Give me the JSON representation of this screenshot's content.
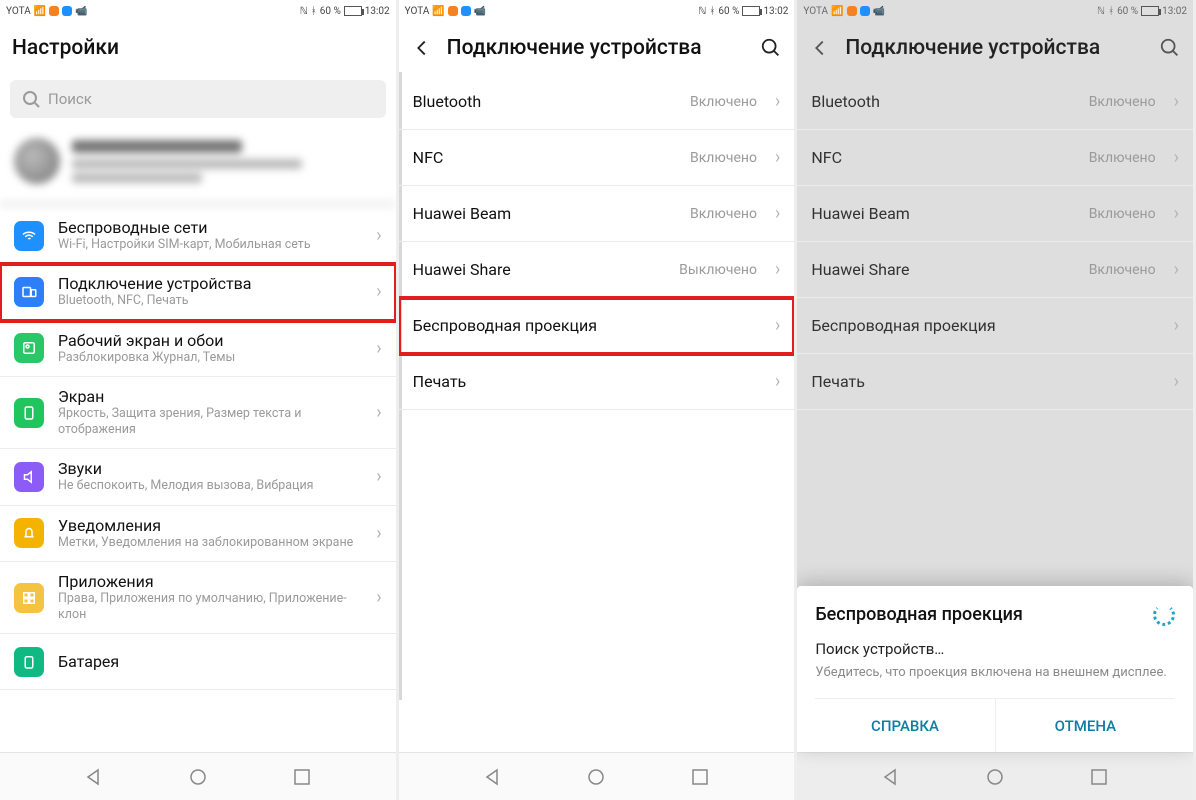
{
  "statusbar": {
    "carrier": "YOTA",
    "battery_pct": "60 %",
    "time": "13:02"
  },
  "screen1": {
    "title": "Настройки",
    "search_placeholder": "Поиск",
    "items": [
      {
        "label": "Беспроводные сети",
        "sub": "Wi-Fi, Настройки SIM-карт, Мобильная сеть"
      },
      {
        "label": "Подключение устройства",
        "sub": "Bluetooth, NFC, Печать"
      },
      {
        "label": "Рабочий экран и обои",
        "sub": "Разблокировка Журнал, Темы"
      },
      {
        "label": "Экран",
        "sub": "Яркость, Защита зрения, Размер текста и отображения"
      },
      {
        "label": "Звуки",
        "sub": "Не беспокоить, Мелодия вызова, Вибрация"
      },
      {
        "label": "Уведомления",
        "sub": "Метки, Уведомления на заблокированном экране"
      },
      {
        "label": "Приложения",
        "sub": "Права, Приложения по умолчанию, Приложение-клон"
      },
      {
        "label": "Батарея",
        "sub": ""
      }
    ]
  },
  "screen2": {
    "title": "Подключение устройства",
    "items": [
      {
        "label": "Bluetooth",
        "status": "Включено"
      },
      {
        "label": "NFC",
        "status": "Включено"
      },
      {
        "label": "Huawei Beam",
        "status": "Включено"
      },
      {
        "label": "Huawei Share",
        "status": "Выключено"
      },
      {
        "label": "Беспроводная проекция",
        "status": ""
      },
      {
        "label": "Печать",
        "status": ""
      }
    ]
  },
  "screen3": {
    "title": "Подключение устройства",
    "items": [
      {
        "label": "Bluetooth",
        "status": "Включено"
      },
      {
        "label": "NFC",
        "status": "Включено"
      },
      {
        "label": "Huawei Beam",
        "status": "Включено"
      },
      {
        "label": "Huawei Share",
        "status": "Включено"
      },
      {
        "label": "Беспроводная проекция",
        "status": ""
      },
      {
        "label": "Печать",
        "status": ""
      }
    ],
    "popup": {
      "title": "Беспроводная проекция",
      "line1": "Поиск устройств…",
      "line2": "Убедитесь, что проекция включена на внешнем дисплее.",
      "help": "СПРАВКА",
      "cancel": "ОТМЕНА"
    }
  }
}
